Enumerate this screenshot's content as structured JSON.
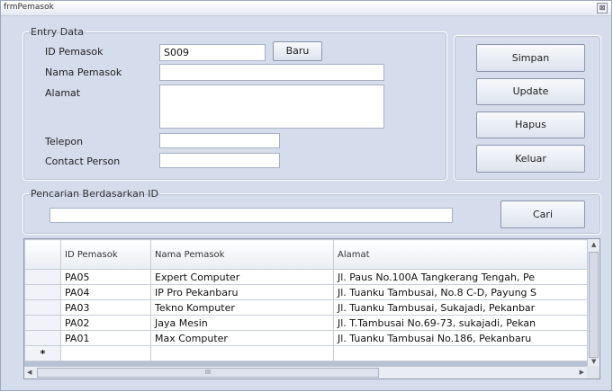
{
  "window": {
    "title": "frmPemasok",
    "sys_glyph": "⊠"
  },
  "entry": {
    "legend": "Entry Data",
    "id_label": "ID Pemasok",
    "id_value": "S009",
    "baru_label": "Baru",
    "nama_label": "Nama Pemasok",
    "nama_value": "",
    "alamat_label": "Alamat",
    "alamat_value": "",
    "telepon_label": "Telepon",
    "telepon_value": "",
    "cp_label": "Contact Person",
    "cp_value": ""
  },
  "actions": {
    "simpan": "Simpan",
    "update": "Update",
    "hapus": "Hapus",
    "keluar": "Keluar"
  },
  "search": {
    "legend": "Pencarian Berdasarkan ID",
    "value": "",
    "button": "Cari"
  },
  "grid": {
    "headers": [
      "ID Pemasok",
      "Nama Pemasok",
      "Alamat"
    ],
    "rows": [
      [
        "PA05",
        "Expert Computer",
        "Jl. Paus No.100A Tangkerang Tengah, Pe"
      ],
      [
        "PA04",
        "IP Pro Pekanbaru",
        "Jl. Tuanku Tambusai, No.8 C-D, Payung S"
      ],
      [
        "PA03",
        "Tekno Komputer",
        "Jl. Tuanku Tambusai, Sukajadi, Pekanbar"
      ],
      [
        "PA02",
        "Jaya Mesin",
        "Jl. T.Tambusai No.69-73, sukajadi, Pekan"
      ],
      [
        "PA01",
        "Max Computer",
        "Jl. Tuanku Tambusai No.186, Pekanbaru"
      ]
    ],
    "new_row_marker": "*",
    "hscroll_grip": "III"
  }
}
